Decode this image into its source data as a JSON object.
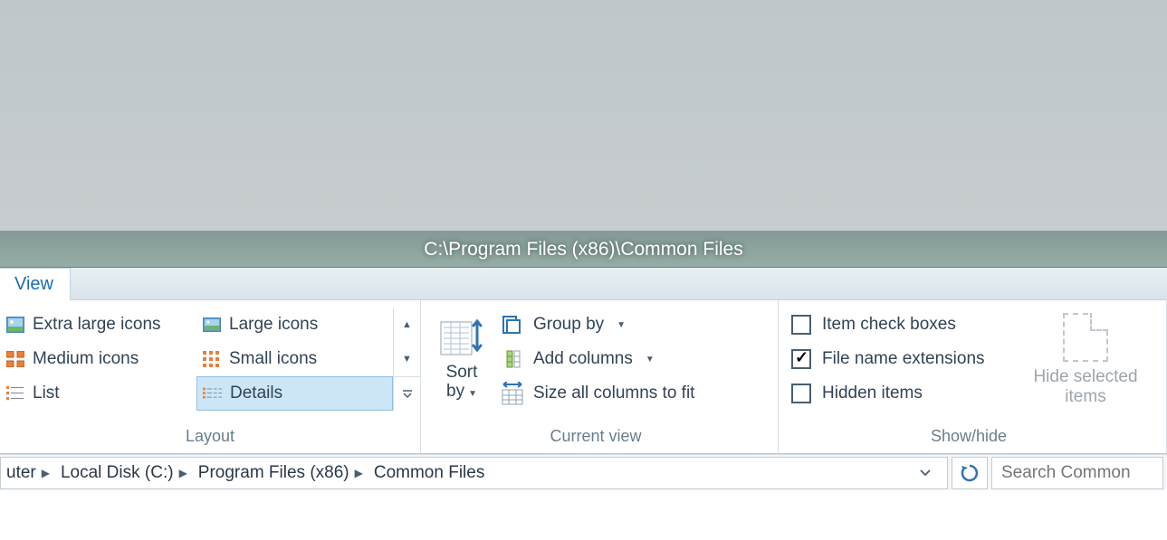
{
  "window": {
    "title": "C:\\Program Files (x86)\\Common Files"
  },
  "tabs": {
    "view": "View"
  },
  "ribbon": {
    "layout": {
      "items": [
        {
          "label": "Extra large icons"
        },
        {
          "label": "Medium icons"
        },
        {
          "label": "List"
        },
        {
          "label": "Large icons"
        },
        {
          "label": "Small icons"
        },
        {
          "label": "Details",
          "selected": true
        }
      ],
      "group_label": "Layout"
    },
    "currentview": {
      "sort_label": "Sort by",
      "groupby_label": "Group by",
      "addcolumns_label": "Add columns",
      "sizecolumns_label": "Size all columns to fit",
      "group_label": "Current view"
    },
    "showhide": {
      "itemcheck_label": "Item check boxes",
      "itemcheck_checked": false,
      "fileext_label": "File name extensions",
      "fileext_checked": true,
      "hidden_label": "Hidden items",
      "hidden_checked": false,
      "hideselected_label": "Hide selected items",
      "group_label": "Show/hide"
    }
  },
  "addressbar": {
    "segments": [
      "uter",
      "Local Disk (C:)",
      "Program Files (x86)",
      "Common Files"
    ]
  },
  "search": {
    "placeholder": "Search Common"
  }
}
